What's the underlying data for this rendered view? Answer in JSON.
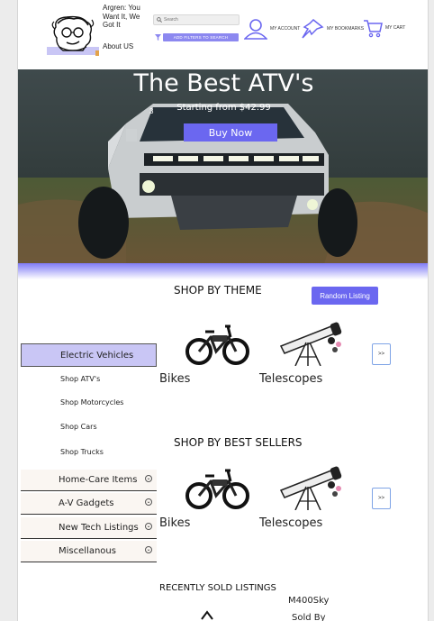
{
  "header": {
    "tagline": "Argren: You Want It, We Got It",
    "about_link": "About US",
    "search_placeholder": "Search",
    "filter_button": "ADD FILTERS TO SEARCH",
    "account_label": "MY ACCOUNT",
    "bookmarks_label": "MY BOOKMARKS",
    "cart_label": "MY CART"
  },
  "hero": {
    "title": "The Best ATV's",
    "subtitle": "Starting from $42.99",
    "buy_button": "Buy Now",
    "badge_number": "3"
  },
  "theme_section": {
    "title": "SHOP BY THEME",
    "random_button": "Random Listing",
    "products": [
      {
        "label": "Bikes",
        "image": "e-bike-image"
      },
      {
        "label": "Telescopes",
        "image": "telescope-image"
      }
    ],
    "next_button": ">>"
  },
  "bestseller_section": {
    "title": "SHOP BY BEST SELLERS",
    "products": [
      {
        "label": "Bikes",
        "image": "e-bike-image"
      },
      {
        "label": "Telescopes",
        "image": "telescope-image"
      }
    ],
    "next_button": ">>"
  },
  "sidebar": {
    "active_category": "Electric Vehicles",
    "sub_items": [
      "Shop ATV's",
      "Shop Motorcycles",
      "Shop Cars",
      "Shop Trucks"
    ],
    "categories": [
      "Home-Care Items",
      "A-V Gadgets",
      "New Tech Listings",
      "Miscellanous"
    ]
  },
  "recent": {
    "title": "RECENTLY SOLD LISTINGS",
    "item_name": "M400Sky",
    "item_status": "Sold By"
  },
  "colors": {
    "accent": "#6b67f0",
    "accent_light": "#c9c6f5",
    "next_border": "#7fa4e6"
  }
}
